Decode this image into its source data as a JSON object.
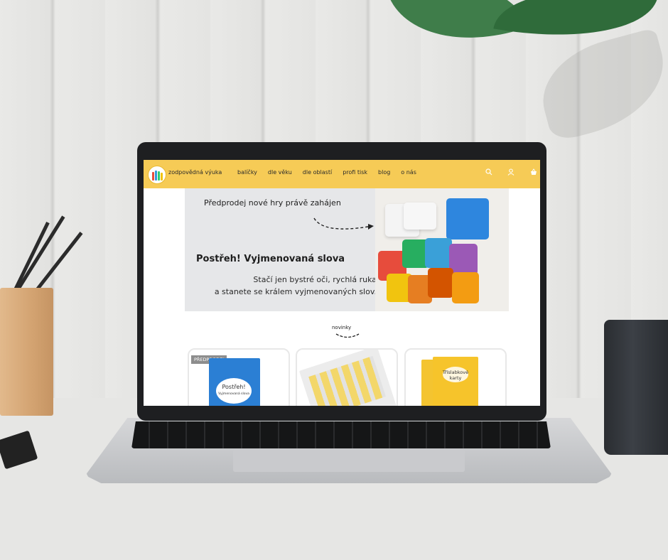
{
  "site": {
    "brand": "zodpovědná výuka",
    "menu": [
      {
        "label": "balíčky"
      },
      {
        "label": "dle věku"
      },
      {
        "label": "dle oblastí"
      },
      {
        "label": "profi tisk"
      },
      {
        "label": "blog"
      },
      {
        "label": "o nás"
      }
    ],
    "icons": [
      "search-icon",
      "user-icon",
      "basket-icon"
    ],
    "accent_color": "#f6cb56"
  },
  "banner": {
    "presale_text": "Předprodej nové hry právě zahájen",
    "title": "Postřeh! Vyjmenovaná slova",
    "subtitle_line1": "Stačí jen bystré oči, rychlá ruka",
    "subtitle_line2": "a stanete se králem vyjmenovaných slov."
  },
  "news": {
    "title": "novinky",
    "cards": [
      {
        "tag": "PŘEDPRODEJ",
        "product_title": "Postřeh!",
        "product_subtitle": "Vyjmenovaná slova"
      },
      {
        "tag": "",
        "product_title": "",
        "product_subtitle": ""
      },
      {
        "tag": "",
        "product_title": "Tříslabkové karty",
        "product_subtitle": ""
      }
    ]
  }
}
